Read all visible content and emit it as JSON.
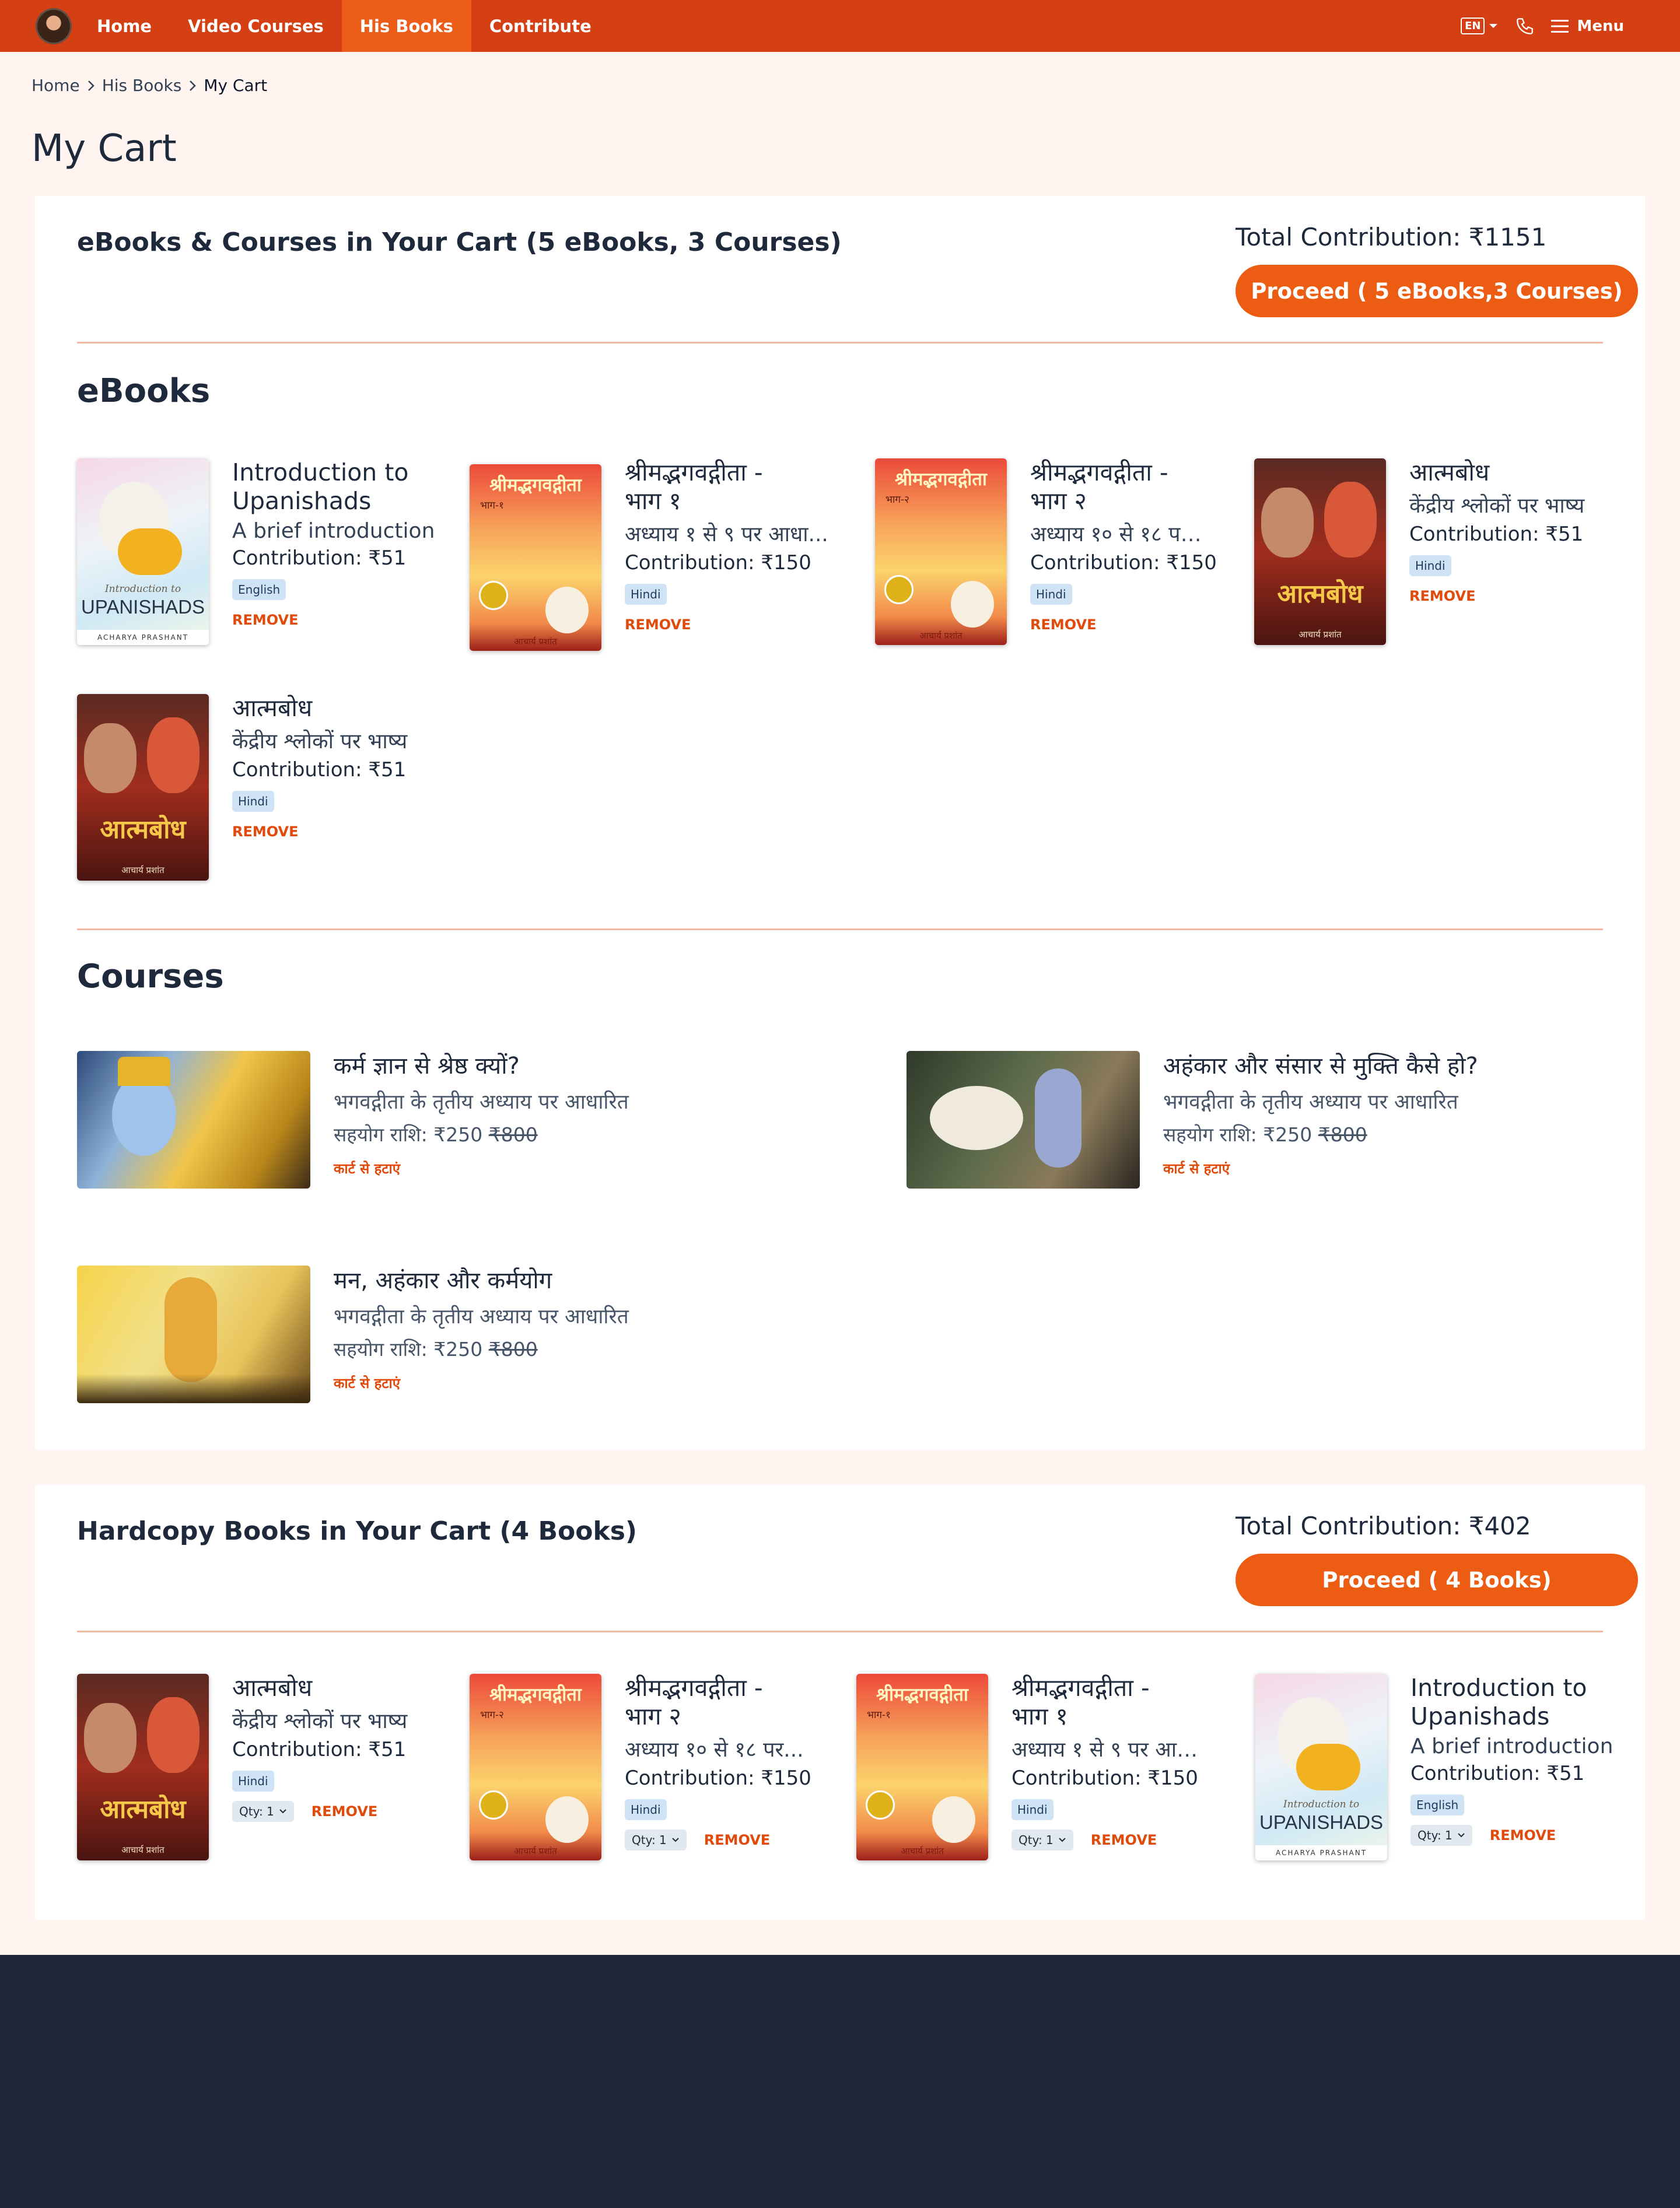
{
  "nav": {
    "links": [
      "Home",
      "Video Courses",
      "His Books",
      "Contribute"
    ],
    "active_index": 2,
    "lang": "EN",
    "menu_label": "Menu"
  },
  "breadcrumb": [
    "Home",
    "His Books",
    "My Cart"
  ],
  "page_title": "My Cart",
  "digital": {
    "title": "eBooks & Courses in Your Cart (5 eBooks, 3 Courses)",
    "total": "Total Contribution: ₹1151",
    "proceed": "Proceed ( 5 eBooks,3 Courses)",
    "ebooks_heading": "eBooks",
    "courses_heading": "Courses",
    "ebooks": [
      {
        "title": "Introduction to Upanishads",
        "subtitle": "A brief introduction",
        "contribution": "Contribution: ₹51",
        "lang": "English",
        "remove": "REMOVE"
      },
      {
        "title": "श्रीमद्भगवद्गीता - भाग १",
        "subtitle": "अध्याय १ से ९ पर आधा...",
        "contribution": "Contribution: ₹150",
        "lang": "Hindi",
        "remove": "REMOVE"
      },
      {
        "title": "श्रीमद्भगवद्गीता - भाग २",
        "subtitle": "अध्याय १० से १८ पर...",
        "contribution": "Contribution: ₹150",
        "lang": "Hindi",
        "remove": "REMOVE"
      },
      {
        "title": "आत्मबोध",
        "subtitle": "केंद्रीय श्लोकों पर भाष्य",
        "contribution": "Contribution: ₹51",
        "lang": "Hindi",
        "remove": "REMOVE"
      },
      {
        "title": "आत्मबोध",
        "subtitle": "केंद्रीय श्लोकों पर भाष्य",
        "contribution": "Contribution: ₹51",
        "lang": "Hindi",
        "remove": "REMOVE"
      }
    ],
    "courses": [
      {
        "title": "कर्म ज्ञान से श्रेष्ठ क्यों?",
        "subtitle": "भगवद्गीता के तृतीय अध्याय पर आधारित",
        "price_label": "सहयोग राशि: ₹250",
        "old_price": "₹800",
        "remove": "कार्ट से हटाएं"
      },
      {
        "title": "अहंकार और संसार से मुक्ति कैसे हो?",
        "subtitle": "भगवद्गीता के तृतीय अध्याय पर आधारित",
        "price_label": "सहयोग राशि: ₹250",
        "old_price": "₹800",
        "remove": "कार्ट से हटाएं"
      },
      {
        "title": "मन, अहंकार और कर्मयोग",
        "subtitle": "भगवद्गीता के तृतीय अध्याय पर आधारित",
        "price_label": "सहयोग राशि: ₹250",
        "old_price": "₹800",
        "remove": "कार्ट से हटाएं"
      }
    ]
  },
  "hardcopy": {
    "title": "Hardcopy Books in Your Cart (4 Books)",
    "total": "Total Contribution: ₹402",
    "proceed": "Proceed ( 4 Books)",
    "books": [
      {
        "title": "आत्मबोध",
        "subtitle": "केंद्रीय श्लोकों पर भाष्य",
        "contribution": "Contribution: ₹51",
        "lang": "Hindi",
        "qty": "Qty: 1",
        "remove": "REMOVE"
      },
      {
        "title": "श्रीमद्भगवद्गीता - भाग २",
        "subtitle": "अध्याय १० से १८ पर...",
        "contribution": "Contribution: ₹150",
        "lang": "Hindi",
        "qty": "Qty: 1",
        "remove": "REMOVE"
      },
      {
        "title": "श्रीमद्भगवद्गीता - भाग १",
        "subtitle": "अध्याय १ से ९ पर आधा...",
        "contribution": "Contribution: ₹150",
        "lang": "Hindi",
        "qty": "Qty: 1",
        "remove": "REMOVE"
      },
      {
        "title": "Introduction to Upanishads",
        "subtitle": "A brief introduction",
        "contribution": "Contribution: ₹51",
        "lang": "English",
        "qty": "Qty: 1",
        "remove": "REMOVE"
      }
    ]
  },
  "covers": {
    "upanishads": {
      "line1": "Introduction to",
      "line2": "UPANISHADS",
      "author": "ACHARYA PRASHANT"
    },
    "gita1": {
      "title": "श्रीमद्भगवद्गीता",
      "part": "भाग-१",
      "author": "आचार्य प्रशांत"
    },
    "gita2": {
      "title": "श्रीमद्भगवद्गीता",
      "part": "भाग-२",
      "author": "आचार्य प्रशांत"
    },
    "atmabodh": {
      "title": "आत्मबोध",
      "author": "आचार्य प्रशांत"
    }
  },
  "colors": {
    "nav": "#d43f14",
    "accent": "#ec5c12",
    "footer": "#1e2638"
  }
}
